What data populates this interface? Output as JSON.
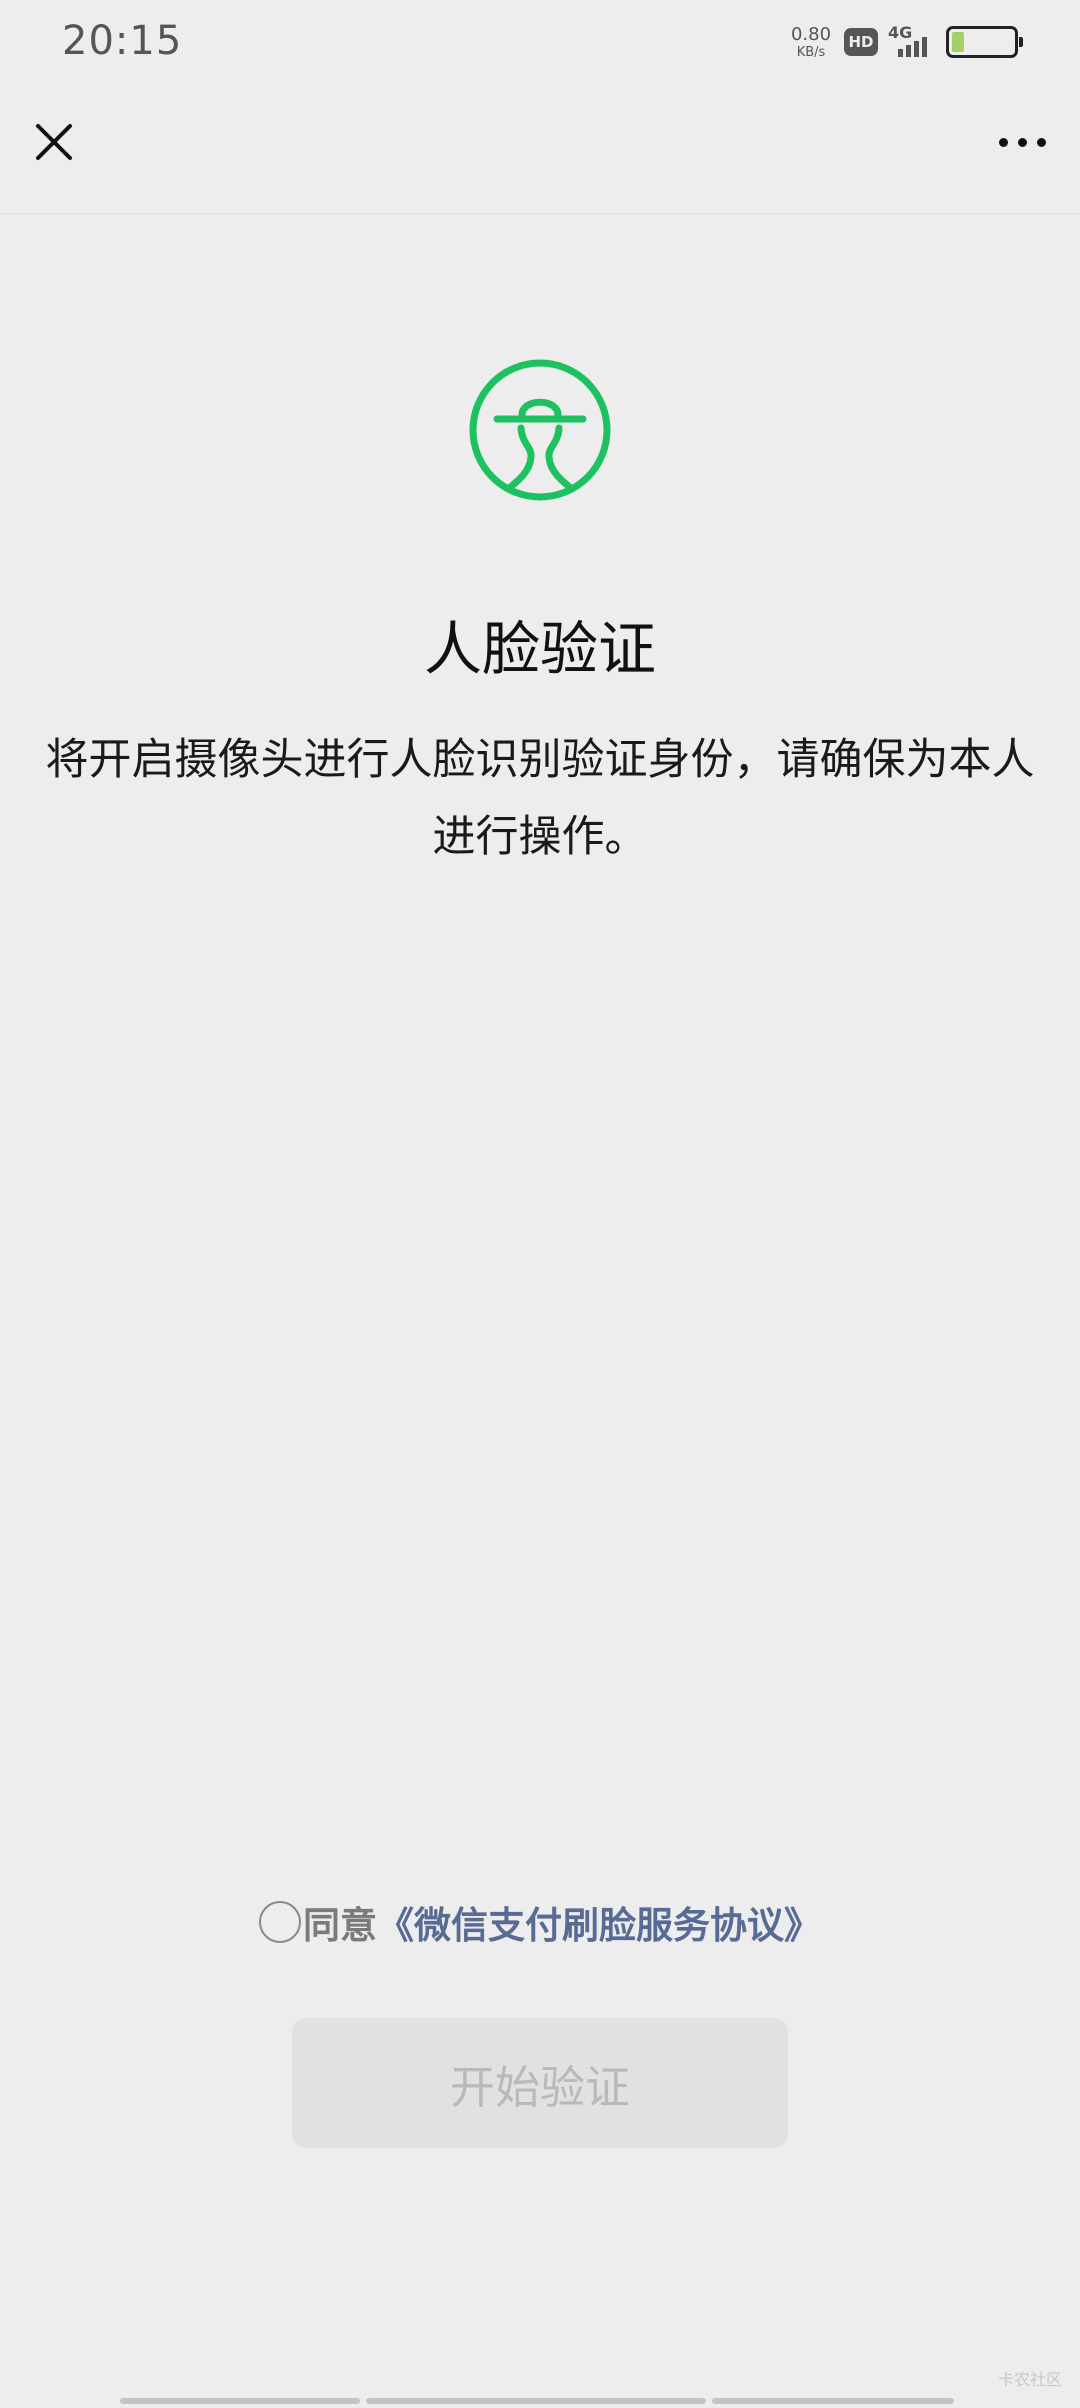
{
  "status_bar": {
    "time": "20:15",
    "net_speed_value": "0.80",
    "net_speed_unit": "KB/s",
    "hd": "HD",
    "network": "4G",
    "battery_level": 0.2,
    "battery_color": "#a4d06a",
    "icons": [
      "hd-icon",
      "signal-icon",
      "battery-icon"
    ]
  },
  "nav": {
    "close_icon": "close-icon",
    "more_icon": "more-icon"
  },
  "main": {
    "icon": "face-verify-icon",
    "icon_color": "#1ec15f",
    "title": "人脸验证",
    "description": "将开启摄像头进行人脸识别验证身份，请确保为本人进行操作。"
  },
  "agreement": {
    "checked": false,
    "prefix": "同意",
    "link": "《微信支付刷脸服务协议》",
    "link_color": "#576b95"
  },
  "start_button": {
    "label": "开始验证",
    "enabled": false
  },
  "watermark": "卡农社区"
}
